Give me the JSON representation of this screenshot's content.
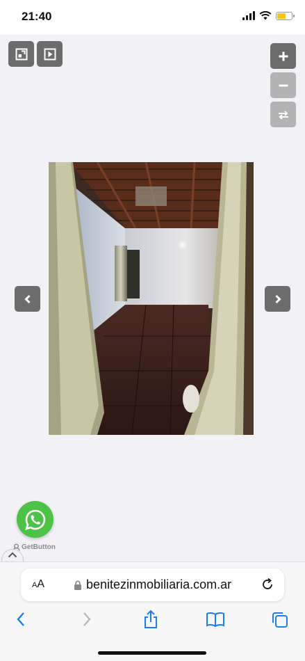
{
  "status_bar": {
    "time": "21:40",
    "icons": [
      "cellular-signal-icon",
      "wifi-icon",
      "battery-icon"
    ],
    "battery_color": "#f5c518"
  },
  "gallery": {
    "controls": {
      "fullscreen_icon": "fullscreen-icon",
      "slideshow_icon": "play-icon",
      "zoom_in_icon": "plus-icon",
      "zoom_out_icon": "minus-icon",
      "rotate_icon": "swap-arrows-icon",
      "prev_icon": "chevron-left-icon",
      "next_icon": "chevron-right-icon"
    },
    "photo": "interior-room-photo"
  },
  "widget": {
    "whatsapp_icon": "whatsapp-icon",
    "whatsapp_color": "#4dc247",
    "getbutton_label": "GetButton"
  },
  "browser": {
    "text_size_label_small": "A",
    "text_size_label_large": "A",
    "url": "benitezinmobiliaria.com.ar",
    "accent_color": "#1a7cf5",
    "toolbar_icons": [
      "back-icon",
      "forward-icon",
      "share-icon",
      "bookmarks-icon",
      "tabs-icon"
    ]
  }
}
